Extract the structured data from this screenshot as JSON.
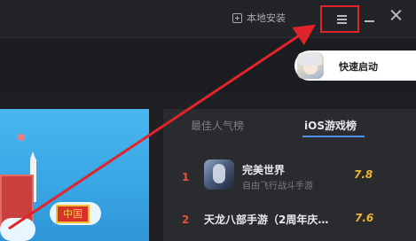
{
  "titlebar": {
    "local_install_label": "本地安装",
    "menu_icon": "hamburger-menu-icon",
    "minimize_icon": "minimize-icon",
    "close_icon": "close-icon",
    "menu_highlight_color": "#e0242a"
  },
  "quick_launch": {
    "label": "快速启动"
  },
  "banner": {
    "badge_text": "中国"
  },
  "rankings": {
    "tabs": [
      {
        "label": "最佳人气榜",
        "active": false
      },
      {
        "label": "iOS游戏榜",
        "active": true
      }
    ],
    "items": [
      {
        "rank": "1",
        "name": "完美世界",
        "desc": "自由飞行战斗手游",
        "score": "7.8"
      },
      {
        "rank": "2",
        "name": "天龙八部手游（2周年庆…",
        "score": "7.6"
      }
    ]
  },
  "annotation": {
    "arrow_color": "#e0242a"
  }
}
